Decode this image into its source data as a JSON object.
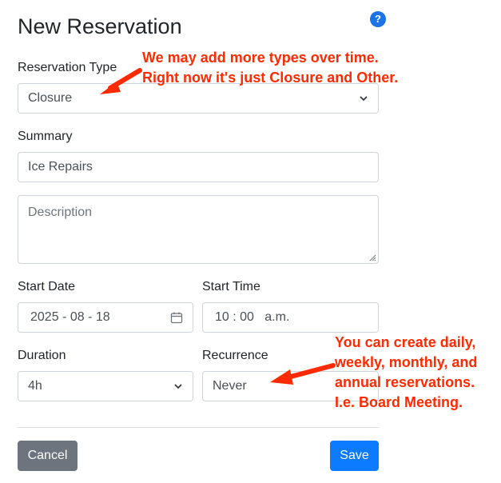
{
  "page": {
    "title": "New Reservation"
  },
  "form": {
    "reservation_type": {
      "label": "Reservation Type",
      "value": "Closure"
    },
    "summary": {
      "label": "Summary",
      "value": "Ice Repairs"
    },
    "description": {
      "placeholder": "Description"
    },
    "start_date": {
      "label": "Start Date",
      "value": "2025 - 08 - 18"
    },
    "start_time": {
      "label": "Start Time",
      "value": "10 : 00   a.m."
    },
    "duration": {
      "label": "Duration",
      "value": "4h"
    },
    "recurrence": {
      "label": "Recurrence",
      "value": "Never"
    }
  },
  "buttons": {
    "cancel": "Cancel",
    "save": "Save"
  },
  "help_icon": "?",
  "annotations": {
    "type_note": [
      "We may add more types over time.",
      "Right now it's just Closure and Other."
    ],
    "recurrence_note": [
      "You can create daily,",
      "weekly, monthly, and",
      "annual reservations.",
      "I.e. Board Meeting."
    ]
  },
  "colors": {
    "accent": "#0d7bff",
    "annotation": "#ff2a00",
    "cancel": "#6c757d"
  }
}
